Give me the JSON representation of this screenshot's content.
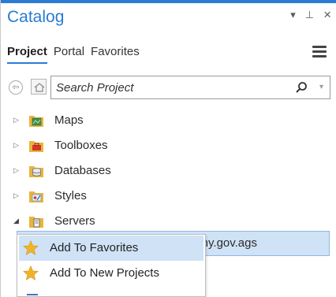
{
  "panel": {
    "title": "Catalog",
    "controls": {
      "dropdown_glyph": "▾",
      "pin_glyph": "⊥",
      "close_glyph": "×"
    }
  },
  "tabs": [
    {
      "label": "Project",
      "active": true
    },
    {
      "label": "Portal",
      "active": false
    },
    {
      "label": "Favorites",
      "active": false
    }
  ],
  "search": {
    "placeholder": "Search Project",
    "back_glyph": "⇦",
    "caret_glyph": "▾"
  },
  "tree": {
    "items": [
      {
        "label": "Maps",
        "icon": "maps-folder-icon",
        "expanded": false
      },
      {
        "label": "Toolboxes",
        "icon": "toolboxes-folder-icon",
        "expanded": false
      },
      {
        "label": "Databases",
        "icon": "databases-folder-icon",
        "expanded": false
      },
      {
        "label": "Styles",
        "icon": "styles-folder-icon",
        "expanded": false
      },
      {
        "label": "Servers",
        "icon": "servers-folder-icon",
        "expanded": true
      }
    ],
    "expand_glyph": "▷",
    "collapse_glyph": "◢",
    "selected_child_label": "s.ny.gov.ags"
  },
  "context_menu": {
    "items": [
      {
        "label": "Add To Favorites",
        "icon": "star-icon",
        "highlighted": true
      },
      {
        "label": "Add To New Projects",
        "icon": "star-icon",
        "highlighted": false
      }
    ]
  },
  "colors": {
    "accent": "#2a7bd4",
    "selection": "#cfe2f6",
    "folder": "#e8b53c",
    "star": "#f0b429"
  }
}
